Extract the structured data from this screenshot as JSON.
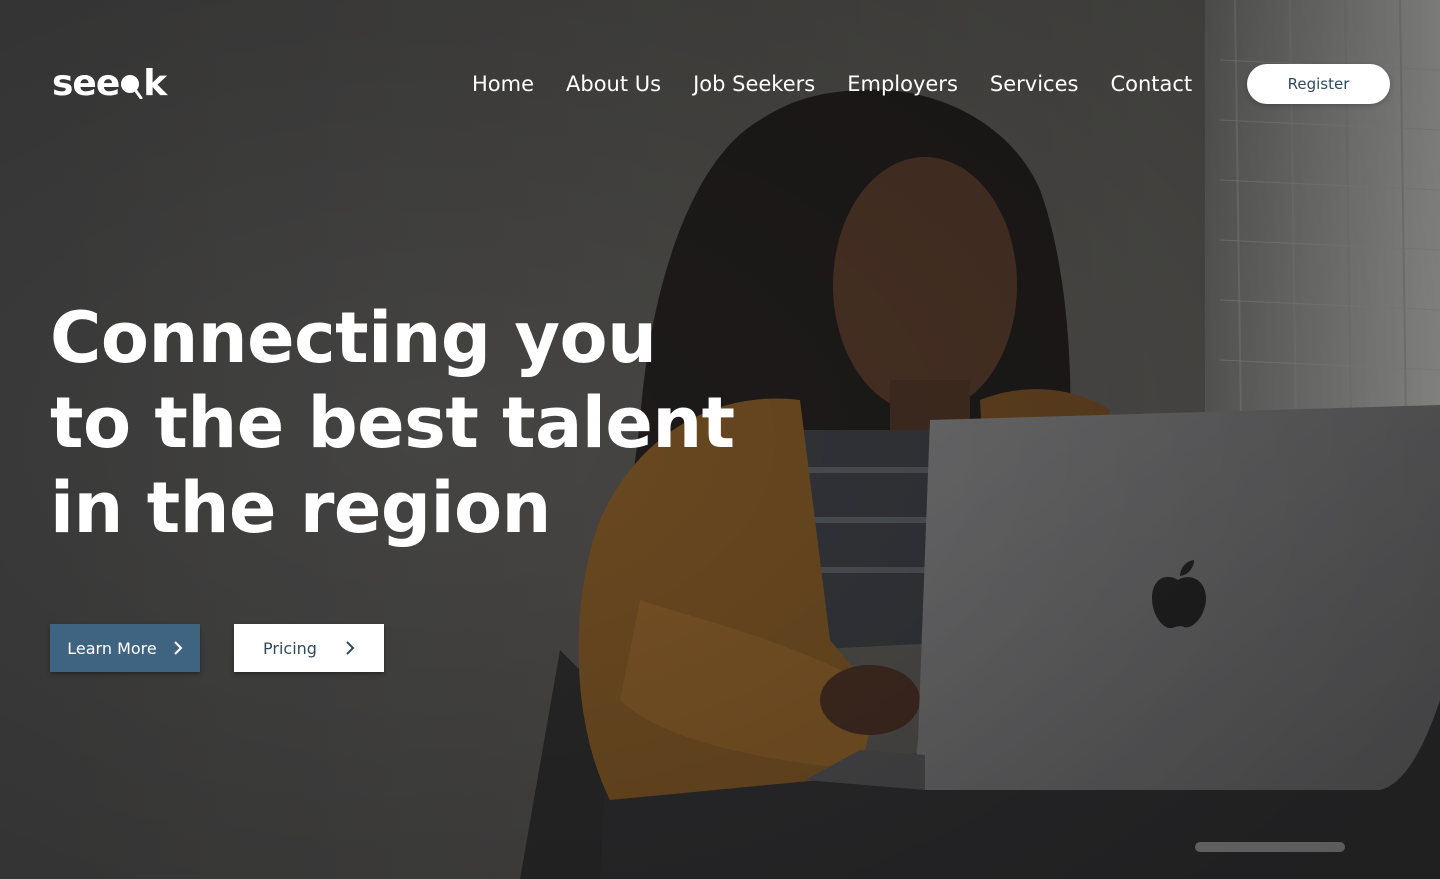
{
  "brand": {
    "logo_part_a": "see",
    "logo_part_b": "k"
  },
  "nav": {
    "items": [
      "Home",
      "About Us",
      "Job Seekers",
      "Employers",
      "Services",
      "Contact"
    ],
    "register_label": "Register"
  },
  "hero": {
    "headline_lines": [
      "Connecting you",
      "to the best talent",
      "in the region"
    ],
    "primary_cta": "Learn More",
    "secondary_cta": "Pricing"
  },
  "colors": {
    "primary_button": "#3f6482",
    "button_text_dark": "#2f4a5f",
    "overlay": "#3c3c3c",
    "sweater": "#8a5a22"
  },
  "icons": [
    "search-magnifier-icon",
    "chevron-right-icon",
    "apple-logo-icon"
  ]
}
